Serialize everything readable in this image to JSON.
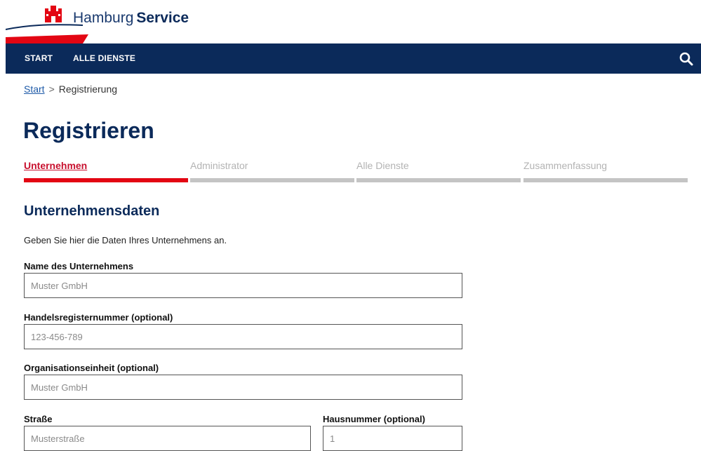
{
  "brand": {
    "name_light": "Hamburg",
    "name_bold": "Service"
  },
  "nav": {
    "items": [
      {
        "label": "START"
      },
      {
        "label": "ALLE DIENSTE"
      }
    ]
  },
  "breadcrumb": {
    "start": "Start",
    "separator": ">",
    "current": "Registrierung"
  },
  "page": {
    "title": "Registrieren"
  },
  "steps": [
    {
      "label": "Unternehmen",
      "active": true
    },
    {
      "label": "Administrator",
      "active": false
    },
    {
      "label": "Alle Dienste",
      "active": false
    },
    {
      "label": "Zusammenfassung",
      "active": false
    }
  ],
  "section": {
    "title": "Unternehmensdaten",
    "description": "Geben Sie hier die Daten Ihres Unternehmens an."
  },
  "form": {
    "company_name": {
      "label": "Name des Unternehmens",
      "placeholder": "Muster GmbH"
    },
    "trade_register": {
      "label": "Handelsregisternummer (optional)",
      "placeholder": "123-456-789"
    },
    "org_unit": {
      "label": "Organisationseinheit (optional)",
      "placeholder": "Muster GmbH"
    },
    "street": {
      "label": "Straße",
      "placeholder": "Musterstraße"
    },
    "house_number": {
      "label": "Hausnummer (optional)",
      "placeholder": "1"
    }
  },
  "colors": {
    "navy": "#0b2a5a",
    "red": "#e30613",
    "inactive": "#c4c4c4"
  },
  "icons": {
    "logo": "hamburg-castle-icon",
    "search": "search-icon"
  }
}
